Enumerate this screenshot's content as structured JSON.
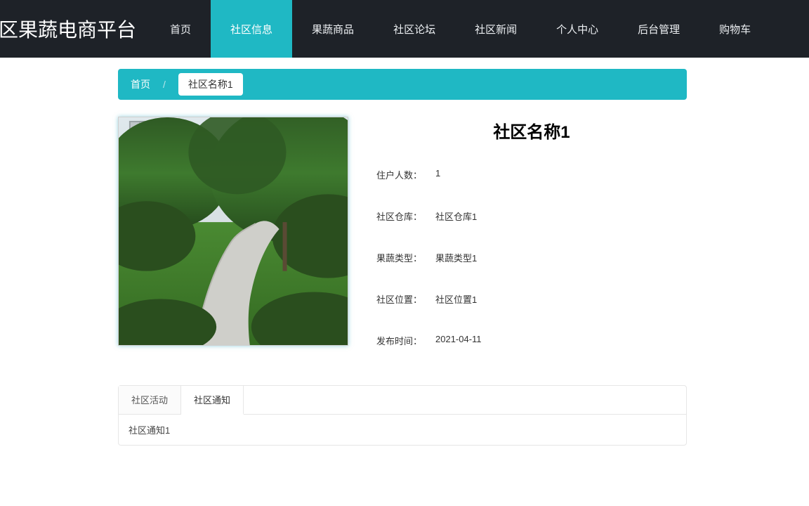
{
  "brand": "社区果蔬电商平台",
  "nav": [
    {
      "label": "首页",
      "active": false
    },
    {
      "label": "社区信息",
      "active": true
    },
    {
      "label": "果蔬商品",
      "active": false
    },
    {
      "label": "社区论坛",
      "active": false
    },
    {
      "label": "社区新闻",
      "active": false
    },
    {
      "label": "个人中心",
      "active": false
    },
    {
      "label": "后台管理",
      "active": false
    },
    {
      "label": "购物车",
      "active": false
    }
  ],
  "breadcrumb": {
    "home": "首页",
    "sep": "/",
    "current": "社区名称1"
  },
  "detail": {
    "title": "社区名称1",
    "rows": [
      {
        "label": "住户人数：",
        "value": "1"
      },
      {
        "label": "社区仓库：",
        "value": "社区仓库1"
      },
      {
        "label": "果蔬类型：",
        "value": "果蔬类型1"
      },
      {
        "label": "社区位置：",
        "value": "社区位置1"
      },
      {
        "label": "发布时间：",
        "value": "2021-04-11"
      }
    ]
  },
  "tabs": [
    {
      "label": "社区活动",
      "active": false
    },
    {
      "label": "社区通知",
      "active": true
    }
  ],
  "tab_content": "社区通知1"
}
